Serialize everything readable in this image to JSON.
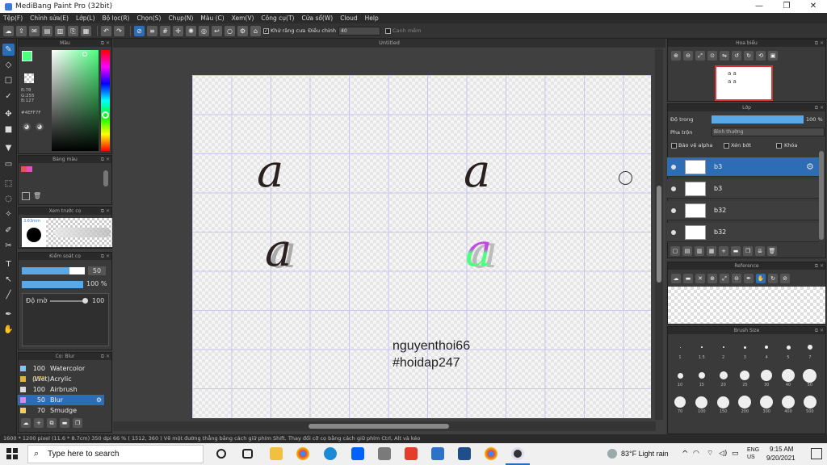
{
  "window": {
    "title": "MediBang Paint Pro (32bit)",
    "minimize": "—",
    "maximize": "❐",
    "close": "✕"
  },
  "menu": [
    "Tệp(F)",
    "Chỉnh sửa(E)",
    "Lớp(L)",
    "Bộ lọc(R)",
    "Chọn(S)",
    "Chụp(N)",
    "Màu (C)",
    "Xem(V)",
    "Công cụ(T)",
    "Cửa sổ(W)",
    "Cloud",
    "Help"
  ],
  "toolbar": {
    "antialias_label": "Khử răng cưa",
    "adjust_label": "Điều chỉnh",
    "adjust_value": "40",
    "snap_label": "Canh mềm"
  },
  "color_panel": {
    "title": "Màu",
    "rgb": "R:78\nG:255\nB:127",
    "hex": "#4EFF7F",
    "primary": "#4eff7f"
  },
  "palette_panel": {
    "title": "Bảng màu",
    "swatches": [
      "#e0554f",
      "#e44fc9"
    ]
  },
  "brush_preview": {
    "title": "Xem trước cọ",
    "size": "3.63mm"
  },
  "brush_control": {
    "title": "Kiểm soát cọ",
    "size_value": "50",
    "opacity_value": "100 %",
    "density_label": "Độ mờ",
    "density_value": "100"
  },
  "brush_list": {
    "title": "Cọ: Blur",
    "items": [
      {
        "size": "100",
        "name": "Watercolor (Wet)",
        "color": "#7fc9f0"
      },
      {
        "size": "173",
        "name": "Acrylic",
        "color": "#e0b040"
      },
      {
        "size": "100",
        "name": "Airbrush",
        "color": "#dddddd"
      },
      {
        "size": "50",
        "name": "Blur",
        "color": "#d58be8",
        "selected": true
      },
      {
        "size": "70",
        "name": "Smudge",
        "color": "#f0d060"
      }
    ]
  },
  "canvas": {
    "tab": "Untitled",
    "watermark_line1": "nguyenthoi66",
    "watermark_line2": "#hoidap247"
  },
  "navigator": {
    "title": "Hoa biểu"
  },
  "layer_panel": {
    "title": "Lớp",
    "opacity_label": "Độ trong",
    "opacity_value": "100 %",
    "blend_label": "Pha trộn",
    "blend_value": "Bình thường",
    "protect_alpha": "Bảo vệ alpha",
    "clipping": "Xén bớt",
    "lock": "Khóa",
    "layers": [
      "b3",
      "b3",
      "b32",
      "b32"
    ]
  },
  "reference_panel": {
    "title": "Reference"
  },
  "brush_size_panel": {
    "title": "Brush Size",
    "row1": [
      "1",
      "1.5",
      "2",
      "3",
      "4",
      "5",
      "7"
    ],
    "row2": [
      "10",
      "15",
      "20",
      "25",
      "30",
      "40",
      "50"
    ],
    "row3": [
      "70",
      "100",
      "150",
      "200",
      "300",
      "400",
      "500"
    ]
  },
  "statusbar": {
    "text": "1600 * 1200 pixel  (11.6 * 8.7cm)  350 dpi  66 %  ( 1512, 360 )  Vẽ một đường thẳng bằng cách giữ phím Shift. Thay đổi cỡ cọ bằng cách giữ phím Ctrl, Alt và kéo"
  },
  "taskbar": {
    "search_placeholder": "Type here to search",
    "weather": "83°F  Light rain",
    "lang": "ENG\nUS",
    "time": "9:15 AM",
    "date": "9/20/2021"
  }
}
